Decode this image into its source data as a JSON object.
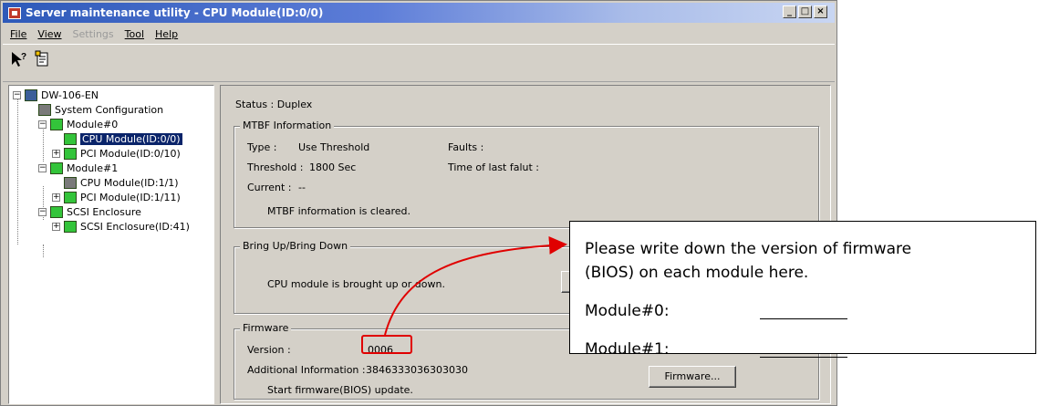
{
  "window": {
    "title": "Server maintenance utility - CPU Module(ID:0/0)",
    "controls": [
      "_",
      "□",
      "×"
    ]
  },
  "menu": [
    {
      "label": "File",
      "disabled": false
    },
    {
      "label": "View",
      "disabled": false
    },
    {
      "label": "Settings",
      "disabled": true
    },
    {
      "label": "Tool",
      "disabled": false
    },
    {
      "label": "Help",
      "disabled": false
    }
  ],
  "toolbar": {
    "help_icon": "whats-this-help-icon",
    "doc_icon": "document-icon"
  },
  "tree": {
    "root": "DW-106-EN",
    "system_configuration": "System Configuration",
    "module0": "Module#0",
    "cpu00": "CPU Module(ID:0/0)",
    "pci00": "PCI Module(ID:0/10)",
    "module1": "Module#1",
    "cpu11": "CPU Module(ID:1/1)",
    "pci11": "PCI Module(ID:1/11)",
    "scsi": "SCSI Enclosure",
    "scsi41": "SCSI Enclosure(ID:41)"
  },
  "status": {
    "text": "Status :  Duplex"
  },
  "mtbf": {
    "title": "MTBF Information",
    "type_label": "Type :",
    "type_value": "Use Threshold",
    "threshold_label": "Threshold :",
    "threshold_value": "1800 Sec",
    "current_label": "Current :",
    "current_value": "--",
    "faults_label": "Faults :",
    "time_of_last_fault_label": "Time of last falut :",
    "cleared_message": "MTBF information is cleared."
  },
  "bringup": {
    "title": "Bring Up/Bring Down",
    "message": "CPU module is brought up or down."
  },
  "firmware": {
    "title": "Firmware",
    "version_label": "Version :",
    "version_value": "0006",
    "additional_label": "Additional Information :",
    "additional_value": "3846333036303030",
    "update_message": "Start firmware(BIOS) update.",
    "button_label": "Firmware..."
  },
  "callout": {
    "line1": "Please write down the version of firmware",
    "line2": "(BIOS) on each module here.",
    "module0_label": "Module#0:",
    "module1_label": "Module#1:"
  },
  "colors": {
    "titlebar": "#2d59b9",
    "selection": "#0a246a",
    "highlight": "#e00000",
    "window_face": "#d4d0c8"
  }
}
